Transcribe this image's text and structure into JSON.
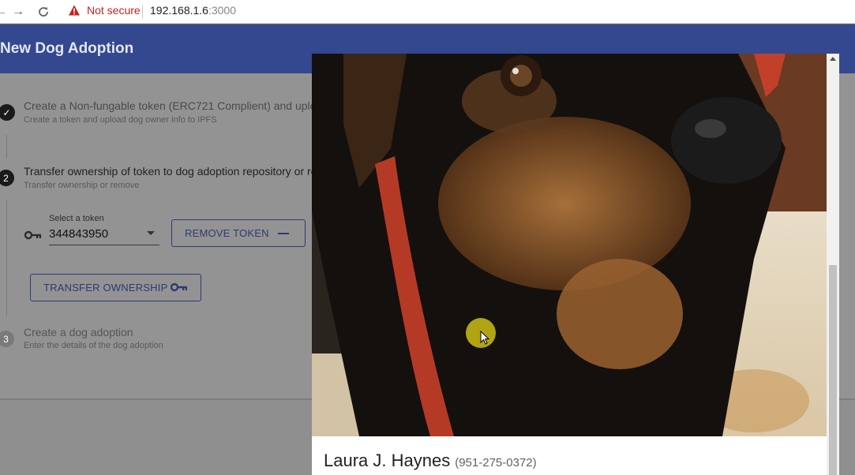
{
  "browser": {
    "security_label": "Not secure",
    "url_host": "192.168.1.6",
    "url_port": ":3000"
  },
  "app": {
    "title": "New Dog Adoption"
  },
  "steps": [
    {
      "number": "1",
      "title": "Create a Non-fungable token (ERC721 Complient) and upload",
      "subtitle": "Create a token and upload dog owner info to IPFS",
      "state": "completed"
    },
    {
      "number": "2",
      "title": "Transfer ownership of token to dog adoption repository or rem",
      "subtitle": "Transfer ownership or remove",
      "state": "active"
    },
    {
      "number": "3",
      "title": "Create a dog adoption",
      "subtitle": "Enter the details of the dog adoption",
      "state": "pending"
    }
  ],
  "token_select": {
    "label": "Select a token",
    "value": "344843950"
  },
  "buttons": {
    "remove_token": "REMOVE TOKEN",
    "transfer_ownership": "TRANSFER OWNERSHIP"
  },
  "modal": {
    "owner_name": "Laura J. Haynes",
    "owner_phone": "(951-275-0372)"
  },
  "colors": {
    "header": "#3f51b5",
    "accent": "#3f51b5",
    "warning": "#c5221f"
  }
}
